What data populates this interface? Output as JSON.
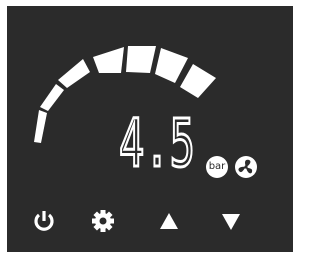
{
  "display": {
    "value": "4.5",
    "unit": "bar",
    "level_segments_total": 7,
    "level_segments_lit": 7
  },
  "icons": {
    "mode": "fan-icon",
    "power": "power-icon",
    "settings": "gear-icon",
    "up": "up-arrow-icon",
    "down": "down-arrow-icon"
  },
  "colors": {
    "panel": "#2b2b2b",
    "foreground": "#ffffff"
  }
}
